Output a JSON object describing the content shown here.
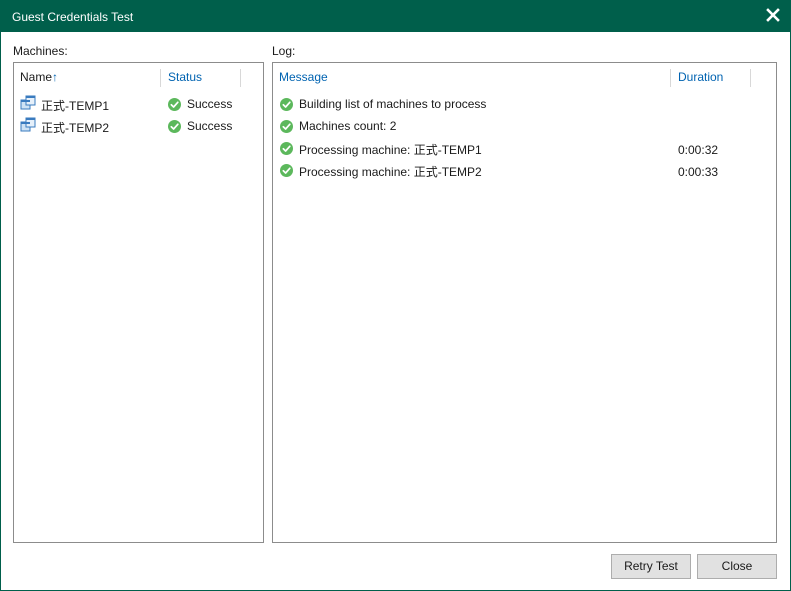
{
  "window": {
    "title": "Guest Credentials Test",
    "accent_color": "#005f4b"
  },
  "machines": {
    "label": "Machines:",
    "columns": {
      "name": "Name",
      "sort_indicator": "↑",
      "status": "Status"
    },
    "rows": [
      {
        "name": "正式-TEMP1",
        "status": "Success",
        "icon": "vm-icon",
        "status_icon": "success-check-icon"
      },
      {
        "name": "正式-TEMP2",
        "status": "Success",
        "icon": "vm-icon",
        "status_icon": "success-check-icon"
      }
    ]
  },
  "log": {
    "label": "Log:",
    "columns": {
      "message": "Message",
      "duration": "Duration"
    },
    "rows": [
      {
        "message": "Building list of machines to process",
        "duration": "",
        "status_icon": "success-check-icon"
      },
      {
        "message": "Machines count: 2",
        "duration": "",
        "status_icon": "success-check-icon"
      },
      {
        "message": "Processing machine: 正式-TEMP1",
        "duration": "0:00:32",
        "status_icon": "success-check-icon"
      },
      {
        "message": "Processing machine: 正式-TEMP2",
        "duration": "0:00:33",
        "status_icon": "success-check-icon"
      }
    ]
  },
  "buttons": {
    "retry": "Retry Test",
    "close": "Close"
  },
  "colors": {
    "success": "#5cb85c",
    "header_link": "#0063b1"
  }
}
